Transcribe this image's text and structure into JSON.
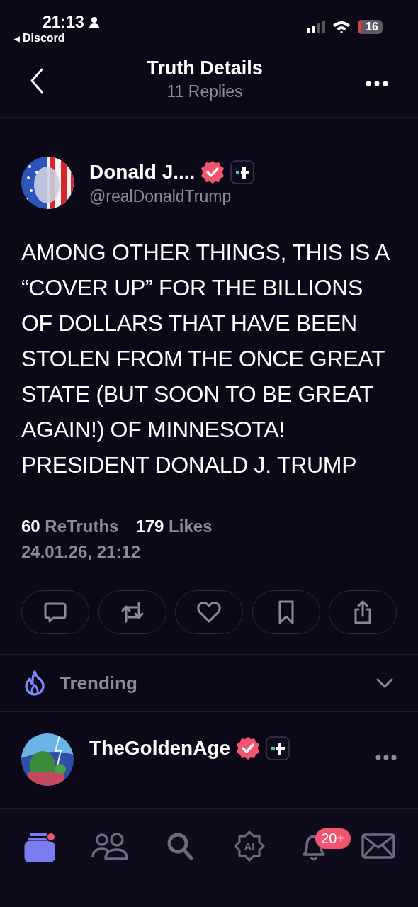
{
  "status_bar": {
    "time": "21:13",
    "back_arrow": "◀",
    "back_app": "Discord",
    "battery": "16"
  },
  "header": {
    "title": "Truth Details",
    "subtitle": "11 Replies"
  },
  "post": {
    "name": "Donald J....",
    "handle": "@realDonaldTrump",
    "verified": true,
    "text": "AMONG OTHER THINGS, THIS IS A “COVER UP” FOR THE BILLIONS OF DOLLARS THAT HAVE BEEN STOLEN FROM THE ONCE GREAT STATE (BUT SOON TO BE GREAT AGAIN!) OF MINNESOTA! PRESIDENT DONALD J. TRUMP",
    "stats": [
      {
        "count": "60",
        "label": "ReTruths"
      },
      {
        "count": "179",
        "label": "Likes"
      }
    ],
    "timestamp": "24.01.26, 21:12",
    "actions": [
      {
        "kind": "reply"
      },
      {
        "kind": "retruth"
      },
      {
        "kind": "like"
      },
      {
        "kind": "bookmark"
      },
      {
        "kind": "share"
      }
    ]
  },
  "trending": {
    "label": "Trending",
    "expanded": false
  },
  "next_post": {
    "name": "TheGoldenAge",
    "verified": true
  },
  "tab_bar": [
    {
      "kind": "home",
      "selected": true,
      "dot": true
    },
    {
      "kind": "people",
      "selected": false
    },
    {
      "kind": "search",
      "selected": false
    },
    {
      "kind": "ai",
      "label": "AI",
      "selected": false
    },
    {
      "kind": "bell",
      "selected": false,
      "badge": "20+"
    },
    {
      "kind": "mail",
      "selected": false
    }
  ]
}
